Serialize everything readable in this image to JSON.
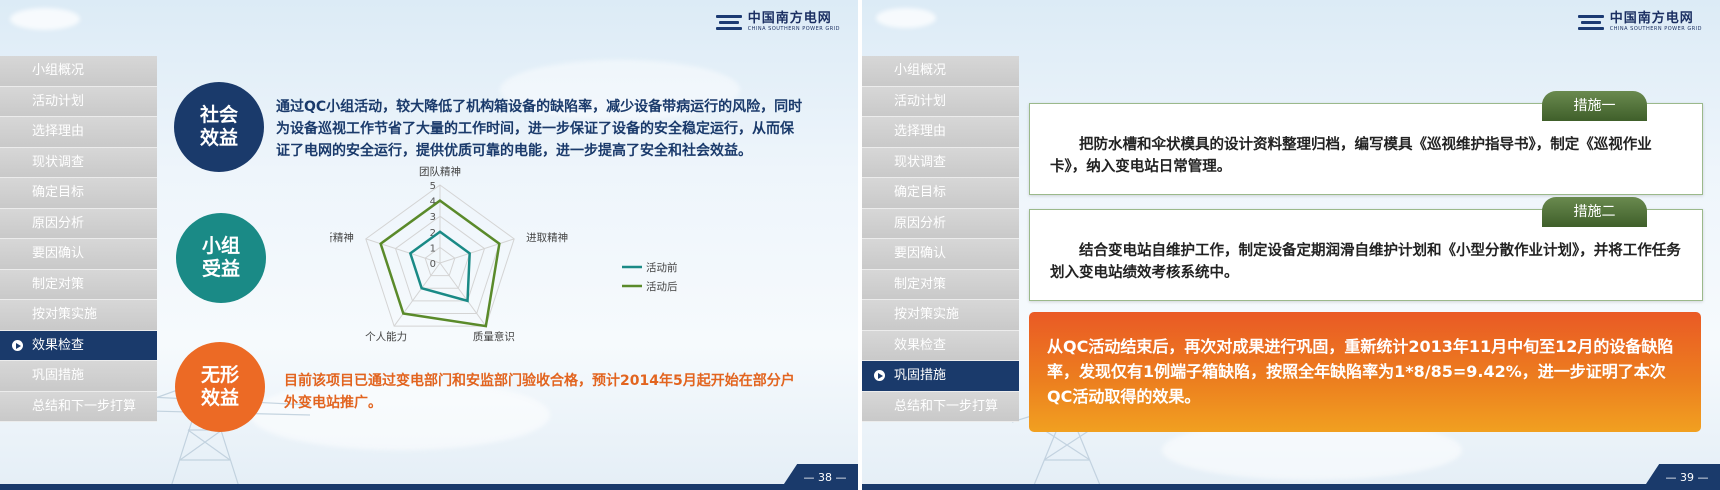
{
  "logo": {
    "name_cn": "中国南方电网",
    "name_en": "CHINA SOUTHERN POWER GRID"
  },
  "sidebar_items": [
    "小组概况",
    "活动计划",
    "选择理由",
    "现状调查",
    "确定目标",
    "原因分析",
    "要因确认",
    "制定对策",
    "按对策实施",
    "效果检查",
    "巩固措施",
    "总结和下一步打算"
  ],
  "slide38": {
    "active_index": 9,
    "page_number": "— 38 —",
    "sections": [
      {
        "circle": "社会效益",
        "color": "#1a3a6b",
        "text": "通过QC小组活动，较大降低了机构箱设备的缺陷率，减少设备带病运行的风险，同时为设备巡视工作节省了大量的工作时间，进一步保证了设备的安全稳定运行，从而保证了电网的安全运行，提供优质可靠的电能，进一步提高了安全和社会效益。",
        "text_color": "#1a3a6b"
      },
      {
        "circle": "小组受益",
        "color": "#1a8a86"
      },
      {
        "circle": "无形效益",
        "color": "#ec6a25",
        "text": "目前该项目已通过变电部门和安监部门验收合格，预计2014年5月起开始在部分户外变电站推广。",
        "text_color": "#e2641f"
      }
    ],
    "chart_data": {
      "type": "radar",
      "axes": [
        "团队精神",
        "进取精神",
        "质量意识",
        "个人能力",
        "创新精神"
      ],
      "rlim": [
        0,
        5
      ],
      "tick_labels": [
        "0",
        "1",
        "2",
        "3",
        "4",
        "5"
      ],
      "series": [
        {
          "name": "活动前",
          "color": "#1a8a86",
          "values": [
            2,
            2,
            3,
            2,
            2
          ]
        },
        {
          "name": "活动后",
          "color": "#5a8a2a",
          "values": [
            4,
            4,
            5,
            4,
            4
          ]
        }
      ],
      "legend": "right"
    }
  },
  "slide39": {
    "active_index": 10,
    "page_number": "— 39 —",
    "measures": [
      {
        "tag": "措施一",
        "text": "把防水槽和伞状模具的设计资料整理归档，编写模具《巡视维护指导书》，制定《巡视作业卡》，纳入变电站日常管理。"
      },
      {
        "tag": "措施二",
        "text": "结合变电站自维护工作，制定设备定期润滑自维护计划和《小型分散作业计划》，并将工作任务划入变电站绩效考核系统中。"
      }
    ],
    "conclusion": "从QC活动结束后，再次对成果进行巩固，重新统计2013年11月中旬至12月的设备缺陷率，发现仅有1例端子箱缺陷，按照全年缺陷率为1*8/85=9.42%，进一步证明了本次QC活动取得的效果。"
  }
}
